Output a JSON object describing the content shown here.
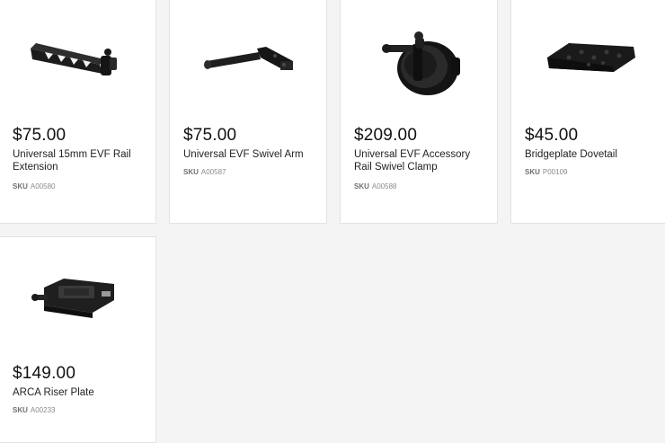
{
  "products": [
    {
      "price": "$75.00",
      "name": "Universal 15mm EVF Rail Extension",
      "sku_label": "SKU",
      "sku": "A00580",
      "icon": "evf-rail-extension-image"
    },
    {
      "price": "$75.00",
      "name": "Universal EVF Swivel Arm",
      "sku_label": "SKU",
      "sku": "A00587",
      "icon": "evf-swivel-arm-image"
    },
    {
      "price": "$209.00",
      "name": "Universal EVF Accessory Rail Swivel Clamp",
      "sku_label": "SKU",
      "sku": "A00588",
      "icon": "swivel-clamp-image"
    },
    {
      "price": "$45.00",
      "name": "Bridgeplate Dovetail",
      "sku_label": "SKU",
      "sku": "P00109",
      "icon": "dovetail-plate-image"
    },
    {
      "price": "$149.00",
      "name": "ARCA Riser Plate",
      "sku_label": "SKU",
      "sku": "A00233",
      "icon": "arca-riser-plate-image"
    }
  ]
}
